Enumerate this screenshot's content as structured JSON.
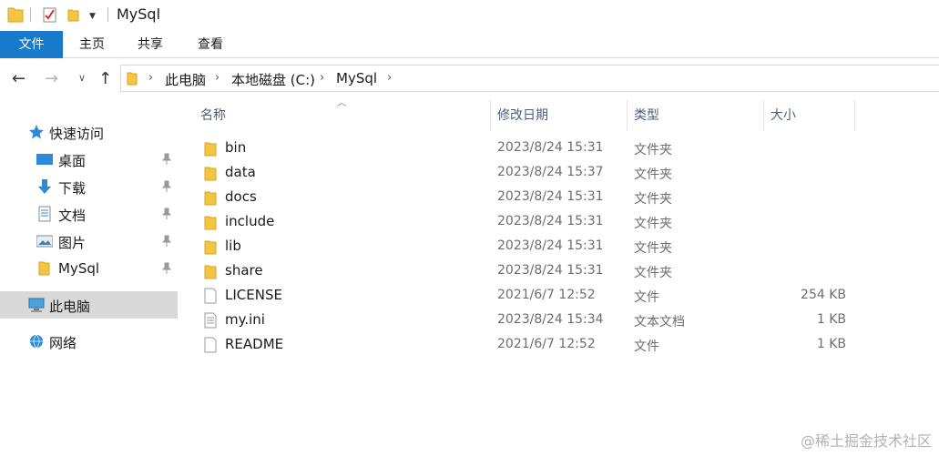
{
  "window": {
    "title": "MySql"
  },
  "ribbon": {
    "tabs": [
      {
        "label": "文件",
        "active": true
      },
      {
        "label": "主页"
      },
      {
        "label": "共享"
      },
      {
        "label": "查看"
      }
    ]
  },
  "address": {
    "crumbs": [
      "此电脑",
      "本地磁盘 (C:)",
      "MySql"
    ]
  },
  "sidebar": {
    "items": [
      {
        "label": "快速访问",
        "icon": "star-icon"
      },
      {
        "label": "桌面",
        "icon": "desktop-icon",
        "pinned": true
      },
      {
        "label": "下载",
        "icon": "download-icon",
        "pinned": true
      },
      {
        "label": "文档",
        "icon": "document-icon",
        "pinned": true
      },
      {
        "label": "图片",
        "icon": "pictures-icon",
        "pinned": true
      },
      {
        "label": "MySql",
        "icon": "folder-icon",
        "pinned": true
      },
      {
        "label": "此电脑",
        "icon": "computer-icon",
        "selected": true
      },
      {
        "label": "网络",
        "icon": "network-icon"
      }
    ]
  },
  "list": {
    "columns": [
      "名称",
      "修改日期",
      "类型",
      "大小"
    ],
    "rows": [
      {
        "name": "bin",
        "date": "2023/8/24 15:31",
        "type": "文件夹",
        "size": "",
        "icon": "folder-icon"
      },
      {
        "name": "data",
        "date": "2023/8/24 15:37",
        "type": "文件夹",
        "size": "",
        "icon": "folder-icon"
      },
      {
        "name": "docs",
        "date": "2023/8/24 15:31",
        "type": "文件夹",
        "size": "",
        "icon": "folder-icon"
      },
      {
        "name": "include",
        "date": "2023/8/24 15:31",
        "type": "文件夹",
        "size": "",
        "icon": "folder-icon"
      },
      {
        "name": "lib",
        "date": "2023/8/24 15:31",
        "type": "文件夹",
        "size": "",
        "icon": "folder-icon"
      },
      {
        "name": "share",
        "date": "2023/8/24 15:31",
        "type": "文件夹",
        "size": "",
        "icon": "folder-icon"
      },
      {
        "name": "LICENSE",
        "date": "2021/6/7 12:52",
        "type": "文件",
        "size": "254 KB",
        "icon": "file-icon"
      },
      {
        "name": "my.ini",
        "date": "2023/8/24 15:34",
        "type": "文本文档",
        "size": "1 KB",
        "icon": "text-file-icon"
      },
      {
        "name": "README",
        "date": "2021/6/7 12:52",
        "type": "文件",
        "size": "1 KB",
        "icon": "file-icon"
      }
    ]
  },
  "watermark": "@稀土掘金技术社区",
  "colors": {
    "accent": "#1979ca",
    "folder": "#f4c542",
    "header_text": "#4c607a",
    "selected_bg": "#d9d9d9"
  }
}
